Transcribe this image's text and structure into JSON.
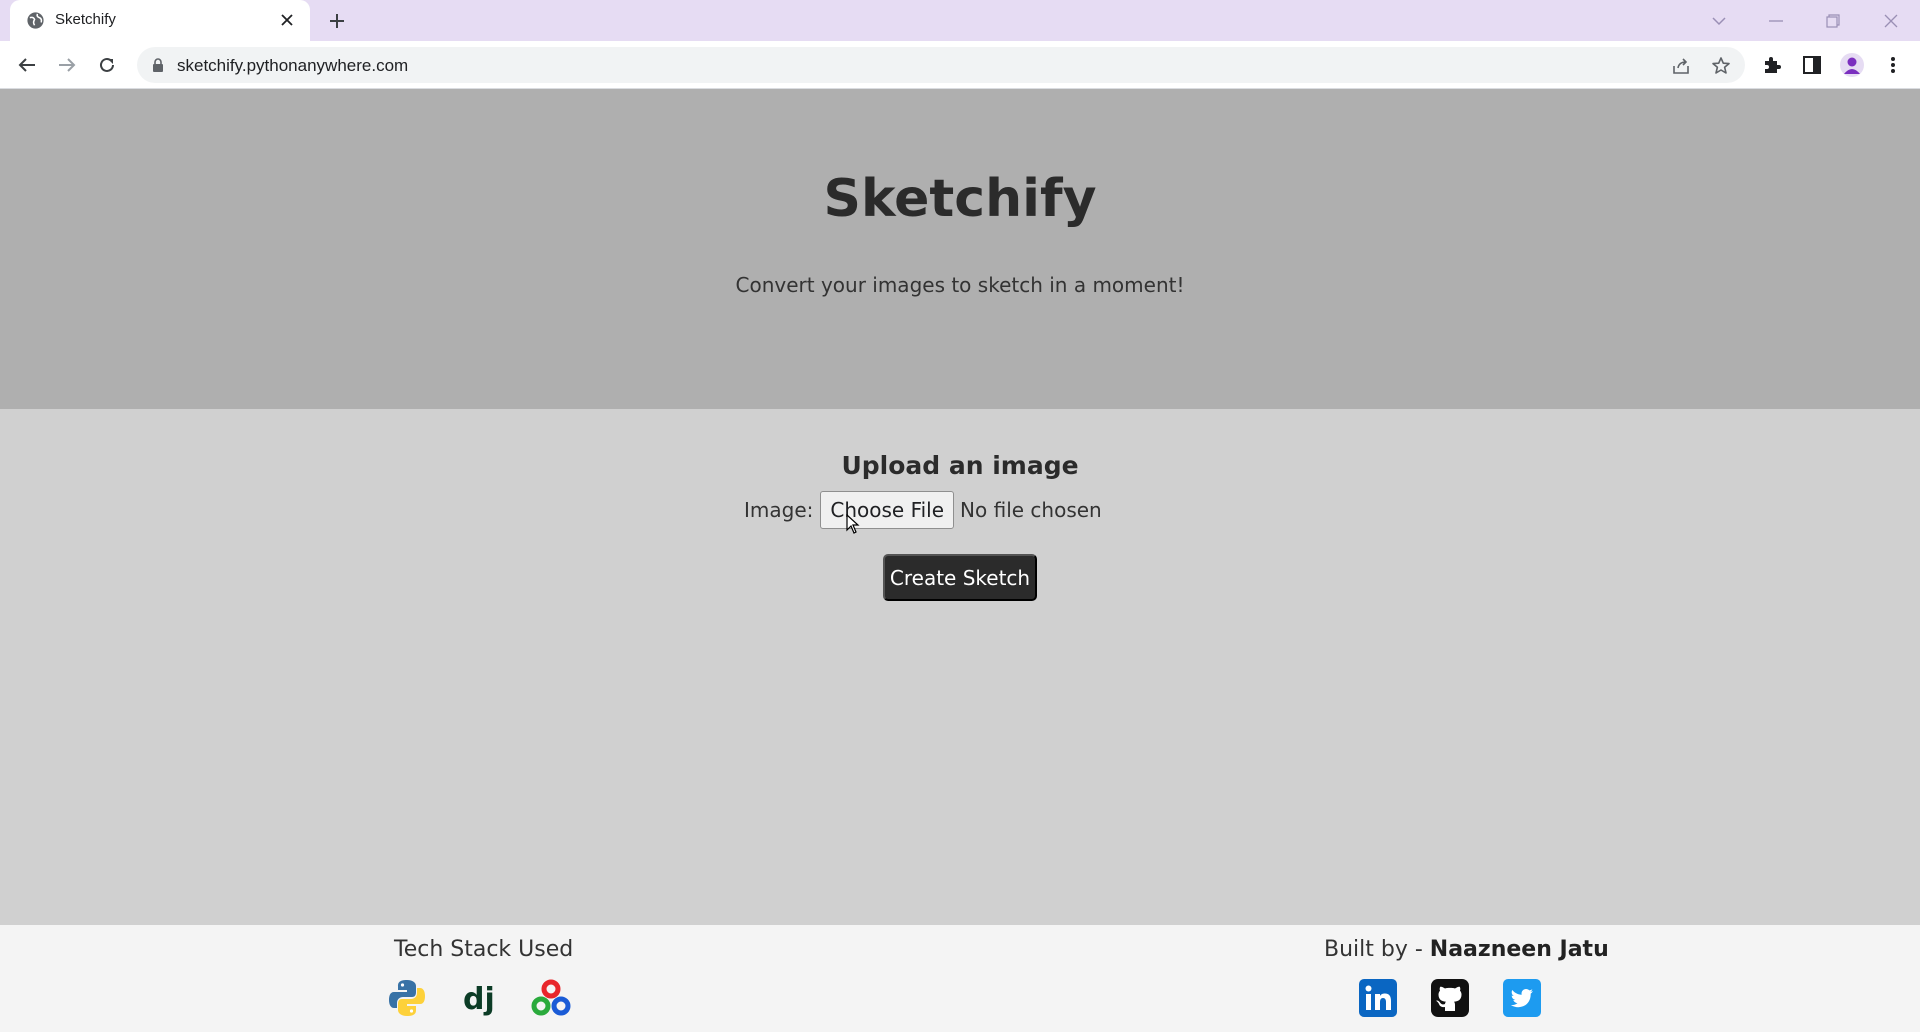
{
  "browser": {
    "tab_title": "Sketchify",
    "url": "sketchify.pythonanywhere.com"
  },
  "hero": {
    "title": "Sketchify",
    "subtitle": "Convert your images to sketch in a moment!"
  },
  "upload": {
    "heading": "Upload an image",
    "image_label": "Image:",
    "choose_file_label": "Choose File",
    "no_file_text": "No file chosen",
    "submit_label": "Create Sketch"
  },
  "footer": {
    "tech_stack_title": "Tech Stack Used",
    "tech_icons": [
      "python-icon",
      "django-icon",
      "opencv-icon"
    ],
    "built_by_prefix": "Built by -",
    "built_by_name": "Naazneen Jatu",
    "social_icons": [
      "linkedin-icon",
      "github-icon",
      "twitter-icon"
    ]
  },
  "colors": {
    "hero_bg": "#afafaf",
    "main_bg": "#d0d0d0",
    "footer_bg": "#f4f4f4",
    "button_bg": "#2b2b2b",
    "linkedin_blue": "#0a66c2",
    "twitter_blue": "#1d9bf0"
  }
}
